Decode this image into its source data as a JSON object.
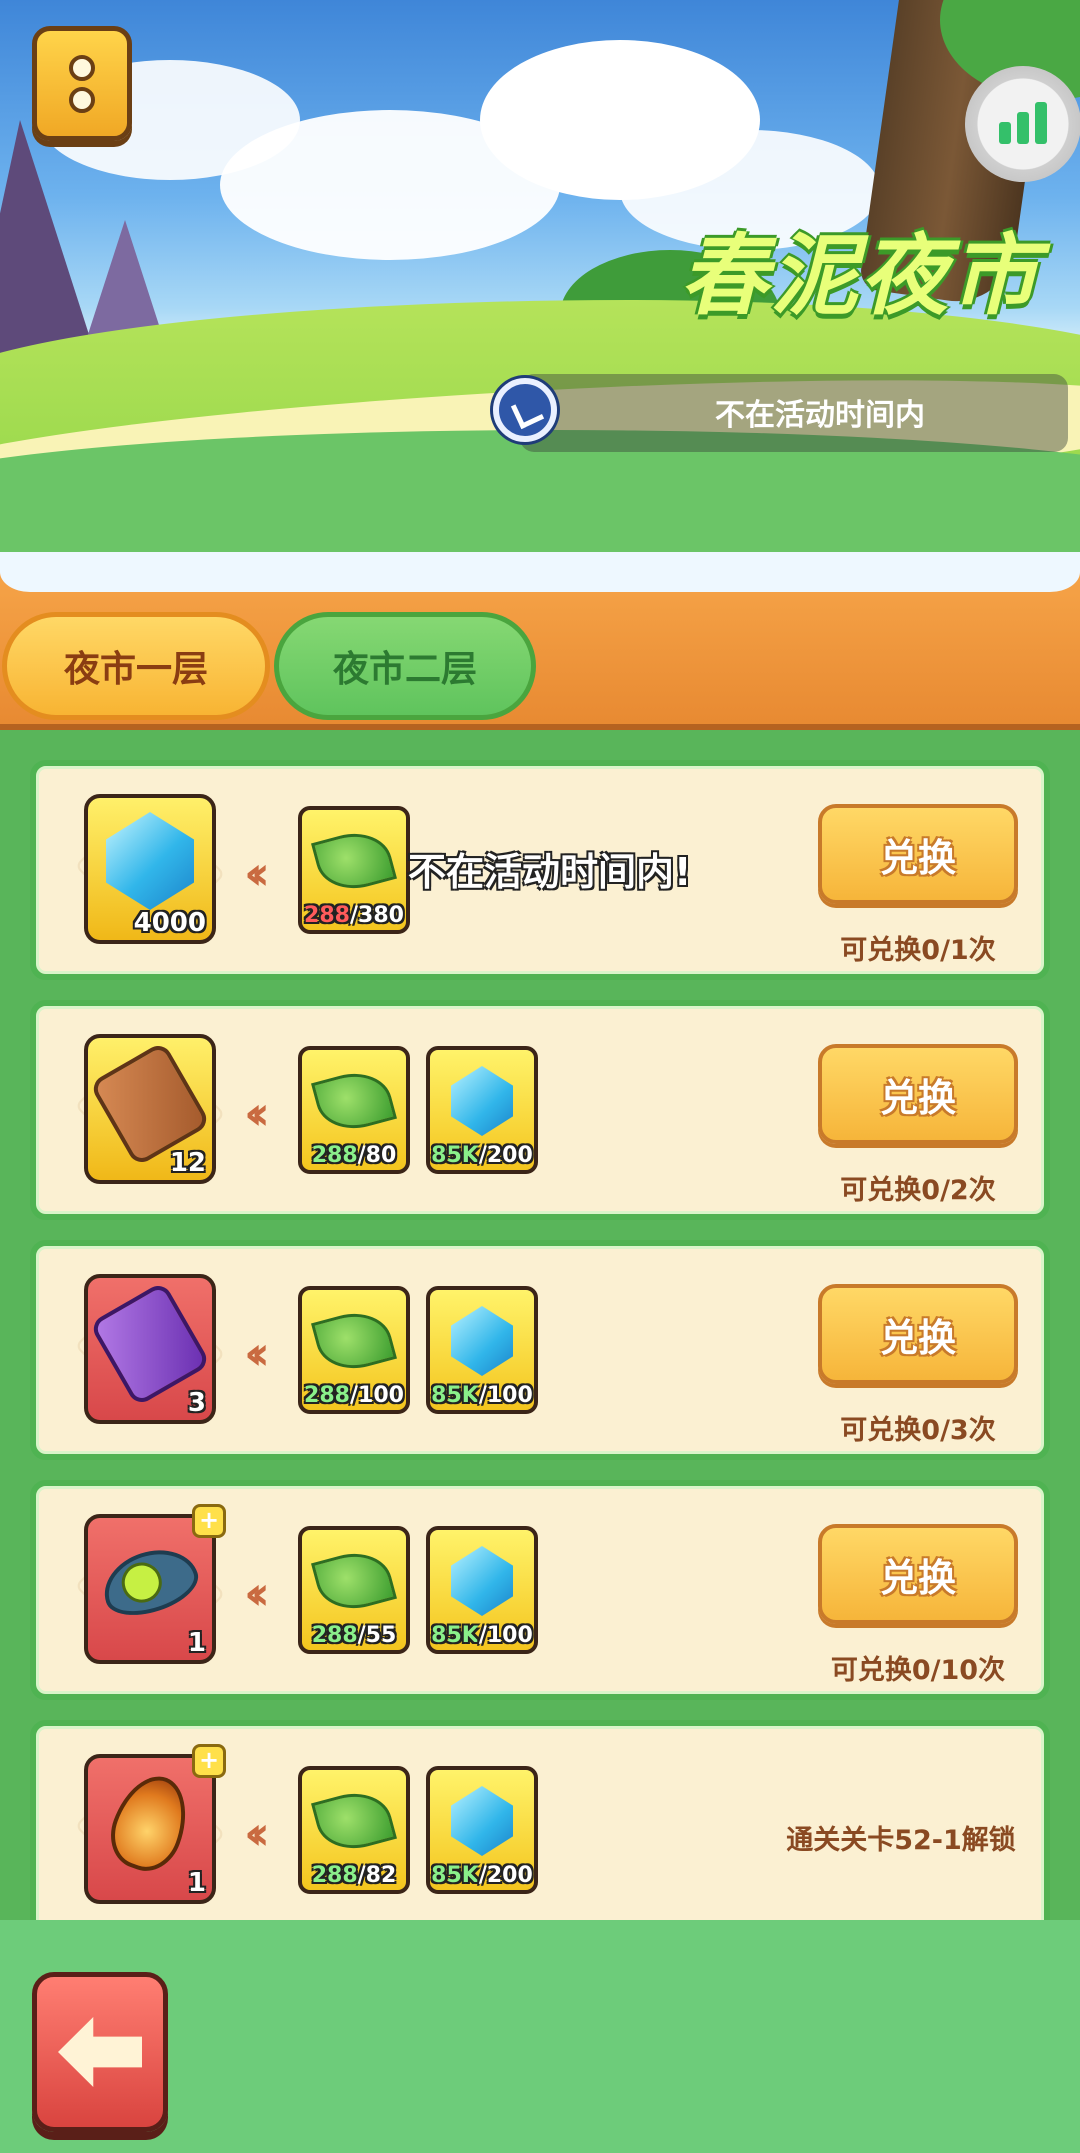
{
  "header": {
    "event_title": "春泥夜市",
    "status_text": "不在活动时间内",
    "menu_icon": "menu-dots-icon",
    "signal_icon": "signal-bars-icon",
    "clock_icon": "clock-icon"
  },
  "tabs": [
    {
      "label": "夜市一层",
      "active": true
    },
    {
      "label": "夜市二层",
      "active": false
    }
  ],
  "toast": "不在活动时间内!",
  "items": [
    {
      "reward_icon": "blue-gem-icon",
      "reward_count": "4000",
      "costs": [
        {
          "icon": "leaf-icon",
          "have": "288",
          "need": "/380"
        }
      ],
      "button": "兑换",
      "limit": "可兑换0/1次"
    },
    {
      "reward_icon": "brown-scroll-icon",
      "reward_count": "12",
      "costs": [
        {
          "icon": "leaf-icon",
          "have": "288",
          "need": "/80"
        },
        {
          "icon": "blue-gem-icon",
          "have": "85K",
          "need": "/200"
        }
      ],
      "button": "兑换",
      "limit": "可兑换0/2次"
    },
    {
      "reward_icon": "purple-scroll-icon",
      "reward_count": "3",
      "costs": [
        {
          "icon": "leaf-icon",
          "have": "288",
          "need": "/100"
        },
        {
          "icon": "blue-gem-icon",
          "have": "85K",
          "need": "/100"
        }
      ],
      "button": "兑换",
      "limit": "可兑换0/3次"
    },
    {
      "reward_icon": "pea-pod-icon",
      "reward_count": "1",
      "costs": [
        {
          "icon": "leaf-icon",
          "have": "288",
          "need": "/55"
        },
        {
          "icon": "blue-gem-icon",
          "have": "85K",
          "need": "/100"
        }
      ],
      "button": "兑换",
      "limit": "可兑换0/10次"
    },
    {
      "reward_icon": "flame-feather-icon",
      "reward_count": "1",
      "costs": [
        {
          "icon": "leaf-icon",
          "have": "288",
          "need": "/82"
        },
        {
          "icon": "blue-gem-icon",
          "have": "85K",
          "need": "/200"
        }
      ],
      "unlock_text": "通关关卡52-1解锁"
    }
  ],
  "footer": {
    "back_icon": "back-arrow-icon"
  }
}
